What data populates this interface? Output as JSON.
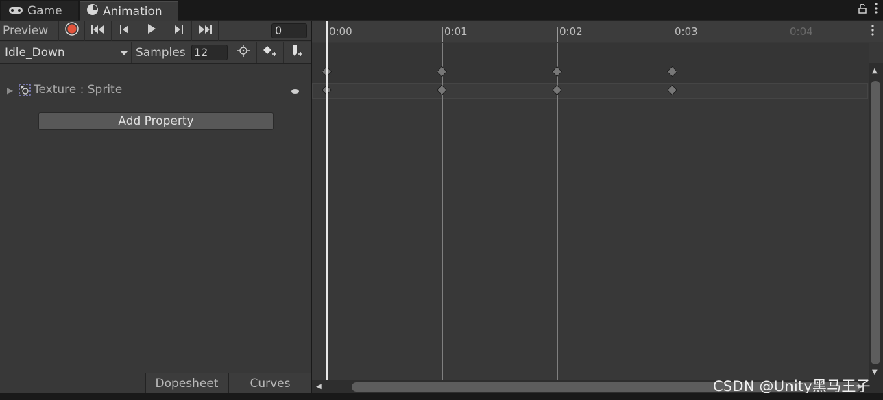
{
  "tabs": [
    {
      "label": "Game",
      "icon": "gamepad-icon"
    },
    {
      "label": "Animation",
      "icon": "clock-icon"
    }
  ],
  "toolbar": {
    "preview_label": "Preview",
    "frame_value": "0"
  },
  "clip": {
    "name": "Idle_Down",
    "samples_label": "Samples",
    "samples_value": "12"
  },
  "properties": [
    {
      "label": "Texture : Sprite"
    }
  ],
  "add_property_label": "Add Property",
  "bottom_tabs": {
    "dopesheet": "Dopesheet",
    "curves": "Curves"
  },
  "timeline": {
    "ticks": [
      "0:00",
      "0:01",
      "0:02",
      "0:03",
      "0:04"
    ],
    "keyframe_ticks": [
      0,
      1,
      2,
      3
    ]
  },
  "watermark": "CSDN @Unity黑马王子",
  "colors": {
    "record": "#e2543c",
    "panel": "#383838",
    "accent_text": "#c4c4c4"
  }
}
